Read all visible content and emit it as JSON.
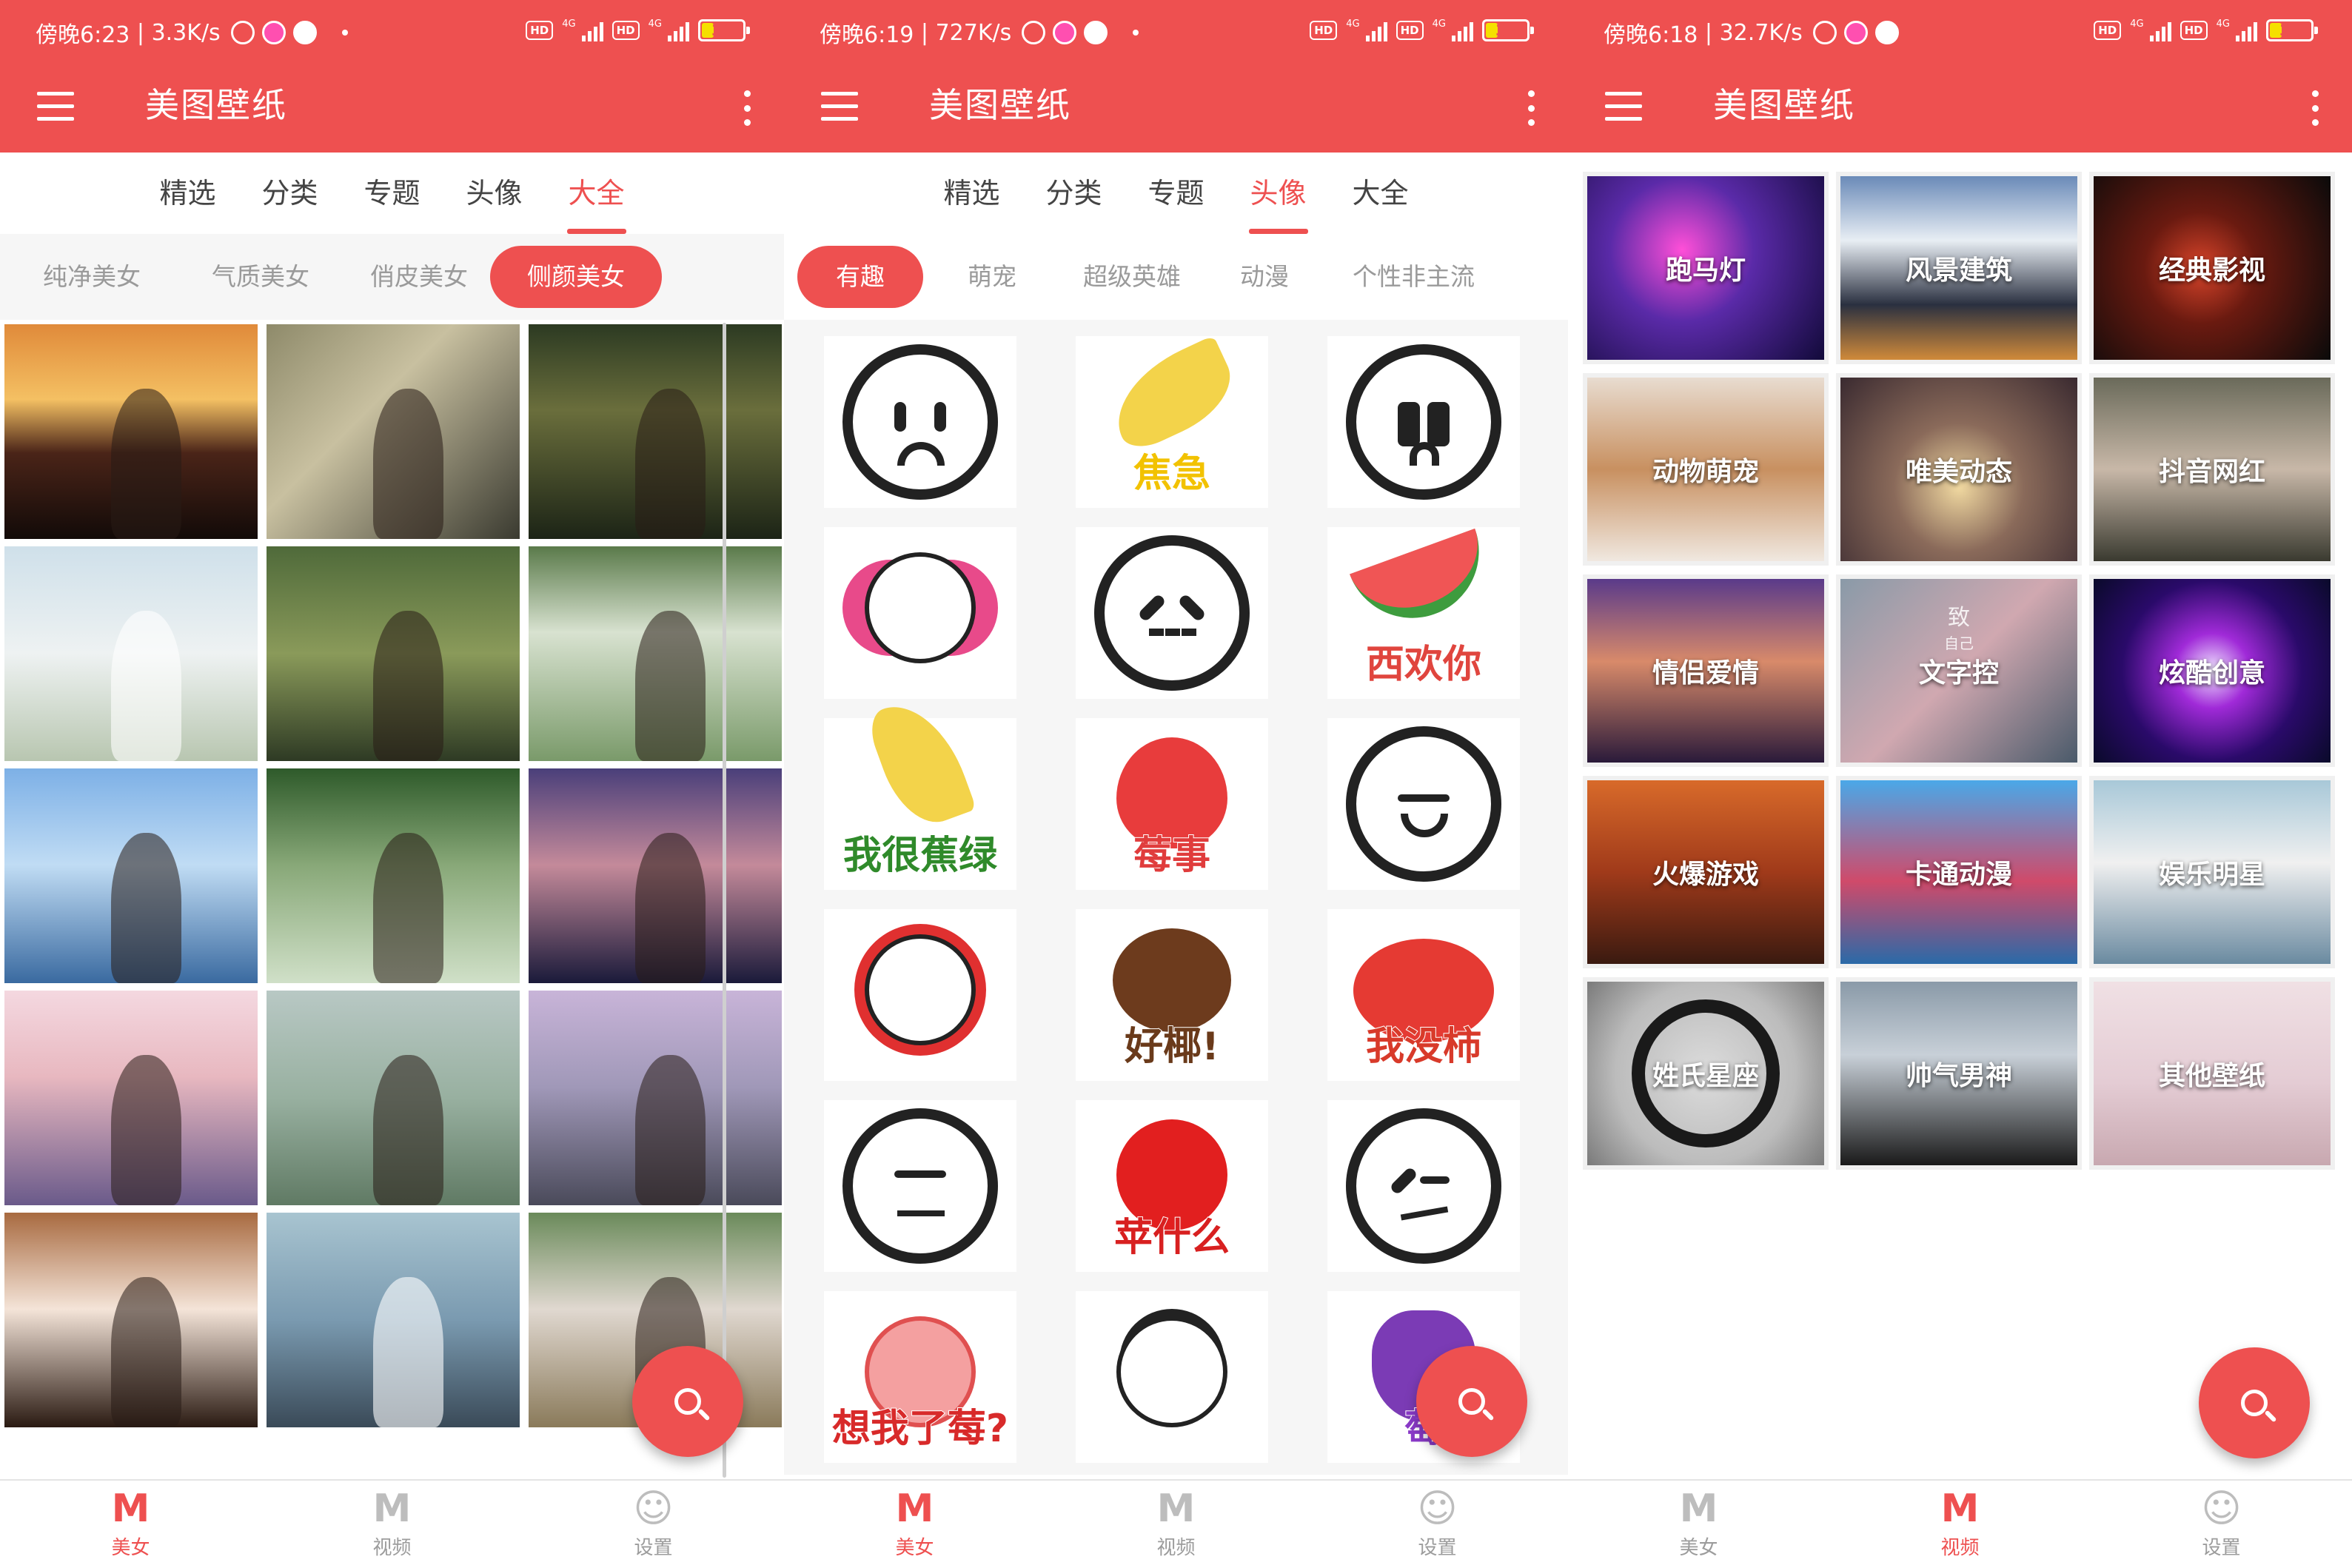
{
  "app": {
    "title": "美图壁纸",
    "accent_color": "#ee5050"
  },
  "tabs": [
    "精选",
    "分类",
    "专题",
    "头像",
    "大全"
  ],
  "nav": [
    "美女",
    "视频",
    "设置"
  ],
  "nav_icons": [
    "M-logo-icon",
    "video-M-icon",
    "person-M-icon"
  ],
  "screens": [
    {
      "status": {
        "time": "傍晚6:23",
        "speed": "3.3K/s",
        "battery": "34",
        "battery_fraction": 0.34,
        "net": "4G"
      },
      "active_tab": "大全",
      "chips": [
        "纯净美女",
        "气质美女",
        "俏皮美女",
        "侧颜美女"
      ],
      "active_chip": "侧颜美女",
      "active_nav": "美女",
      "photos": [
        "sunset-silhouette",
        "girl-fruit-market",
        "forest-girl",
        "girl-white-hat",
        "girl-straw-hat",
        "girl-white-flowers",
        "girl-seaside",
        "girl-green-bush",
        "dusk-lake-girl",
        "girl-blossom",
        "meadow-girl",
        "mermaid-rock",
        "girl-headband",
        "girl-blue-sky",
        "girl-flower-field"
      ]
    },
    {
      "status": {
        "time": "傍晚6:19",
        "speed": "727K/s",
        "battery": "35",
        "battery_fraction": 0.35,
        "net": "4G"
      },
      "active_tab": "头像",
      "chips": [
        "有趣",
        "萌宠",
        "超级英雄",
        "动漫",
        "个性非主流"
      ],
      "active_chip": "有趣",
      "active_nav": "美女",
      "emojis": [
        {
          "kind": "sad-face",
          "caption": ""
        },
        {
          "kind": "banana",
          "caption": "焦急"
        },
        {
          "kind": "scared-face",
          "caption": ""
        },
        {
          "kind": "pink-girl",
          "caption": ""
        },
        {
          "kind": "x-eyes-face",
          "caption": ""
        },
        {
          "kind": "watermelon",
          "caption": "西欢你"
        },
        {
          "kind": "sad-banana",
          "caption": "我很蕉绿"
        },
        {
          "kind": "strawberry",
          "caption": "莓事"
        },
        {
          "kind": "smirk-face",
          "caption": ""
        },
        {
          "kind": "red-hair-girl",
          "caption": ""
        },
        {
          "kind": "coconut",
          "caption": "好椰!"
        },
        {
          "kind": "tomato",
          "caption": "我没柿"
        },
        {
          "kind": "cross-eyes-face",
          "caption": ""
        },
        {
          "kind": "apple",
          "caption": "苹什么"
        },
        {
          "kind": "dizzy-face",
          "caption": ""
        },
        {
          "kind": "strawberry-girl",
          "caption": "想我了莓?"
        },
        {
          "kind": "crown-girl",
          "caption": ""
        },
        {
          "kind": "grape",
          "caption": "萄"
        }
      ]
    },
    {
      "status": {
        "time": "傍晚6:18",
        "speed": "32.7K/s",
        "battery": "35",
        "battery_fraction": 0.35,
        "net": "4G"
      },
      "active_nav": "视频",
      "categories": [
        "跑马灯",
        "风景建筑",
        "经典影视",
        "动物萌宠",
        "唯美动态",
        "抖音网红",
        "情侣爱情",
        "文字控",
        "炫酷创意",
        "火爆游戏",
        "卡通动漫",
        "娱乐明星",
        "姓氏星座",
        "帅气男神",
        "其他壁纸"
      ],
      "category_art_text": {
        "文字控": [
          "致",
          "自己"
        ]
      }
    }
  ],
  "icons": {
    "menu": "menu-icon",
    "more": "more-vert-icon",
    "search": "search-icon"
  }
}
